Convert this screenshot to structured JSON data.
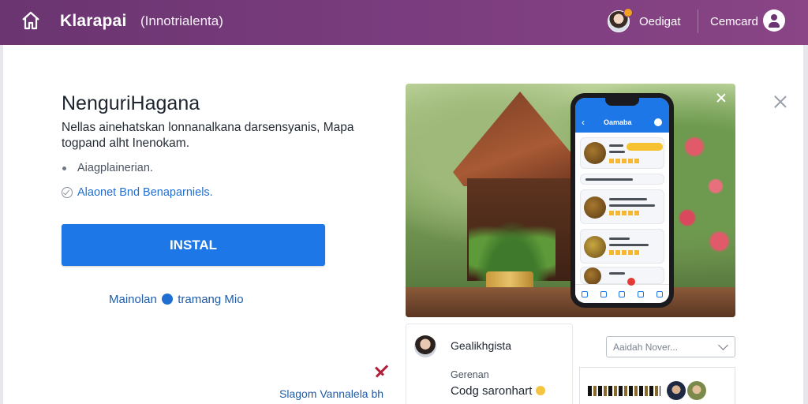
{
  "header": {
    "title": "Klarapai",
    "subtitle": "(Innotrialenta)",
    "user_name": "Oedigat",
    "account_label": "Cemcard"
  },
  "main": {
    "heading": "NenguriHagana",
    "description": "Nellas ainehatskan lonnanalkana darsensyanis, Mapa togpand alht Inenokam.",
    "features": [
      "Aiagplainerian.",
      "Alaonet Bnd Benaparniels."
    ],
    "install_label": "INSTAL",
    "learn_more_prefix": "Mainolan",
    "learn_more_suffix": "tramang Mio",
    "footer_link": "Slagom Vannalela bh"
  },
  "phone": {
    "title": "Oamaba"
  },
  "post": {
    "author": "Gealikhgista",
    "meta": "Gerenan",
    "text": "Codg saronhart"
  },
  "search": {
    "placeholder": "Aaidah Nover..."
  },
  "colors": {
    "header_gradient_start": "#6a3570",
    "header_gradient_end": "#894585",
    "primary_button": "#1d77e6",
    "link": "#1f5ca8"
  },
  "icons": {
    "home": "home-icon",
    "account": "user-circle-icon",
    "close": "close-icon",
    "dropdown": "chevron-down-icon"
  }
}
